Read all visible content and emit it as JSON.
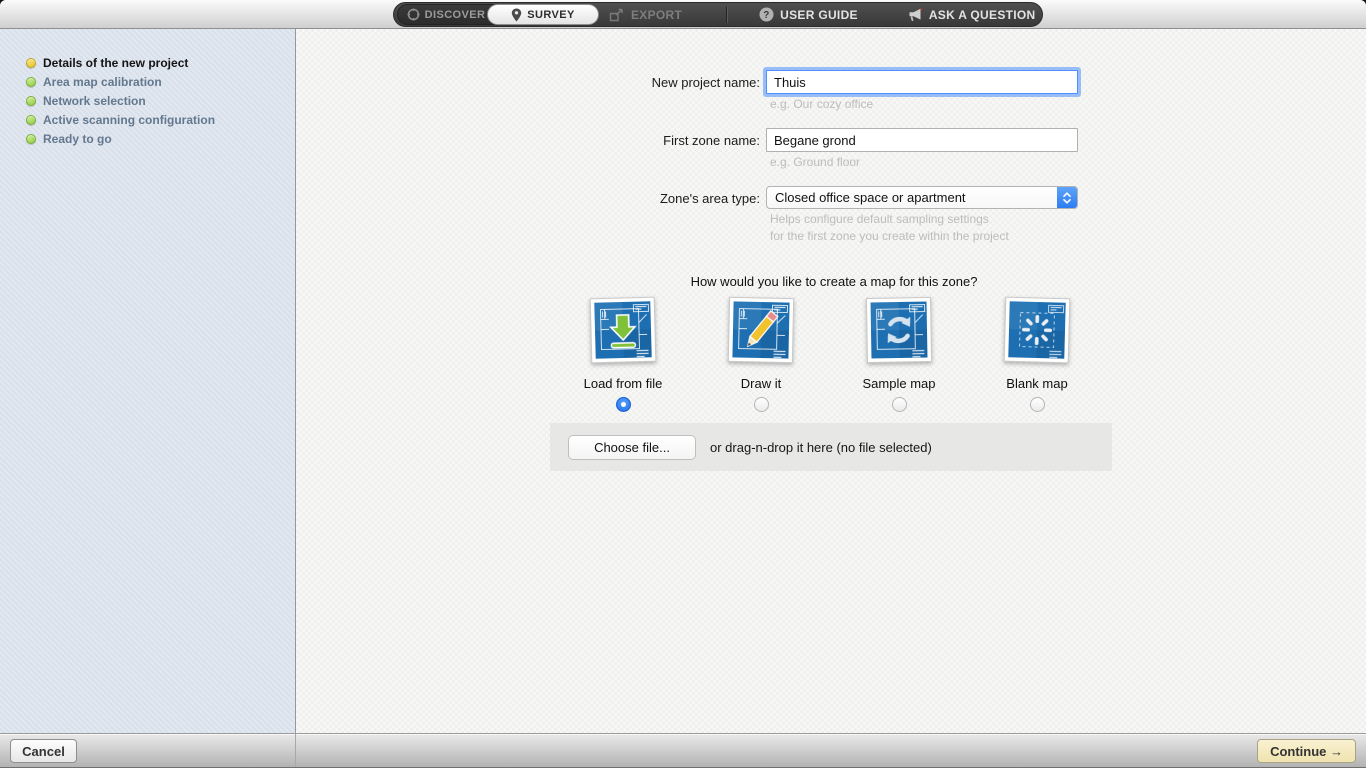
{
  "toolbar": {
    "discover_label": "DISCOVER",
    "survey_label": "SURVEY",
    "export_label": "EXPORT",
    "user_guide_label": "USER GUIDE",
    "ask_question_label": "ASK A QUESTION"
  },
  "sidebar": {
    "steps": [
      {
        "label": "Details of the new project",
        "state": "current"
      },
      {
        "label": "Area map calibration",
        "state": "upcoming"
      },
      {
        "label": "Network selection",
        "state": "upcoming"
      },
      {
        "label": "Active scanning configuration",
        "state": "upcoming"
      },
      {
        "label": "Ready to go",
        "state": "upcoming"
      }
    ]
  },
  "form": {
    "project_name": {
      "label": "New project name:",
      "value": "Thuis",
      "hint": "e.g. Our cozy office"
    },
    "zone_name": {
      "label": "First zone name:",
      "value": "Begane grond",
      "hint": "e.g. Ground floor"
    },
    "area_type": {
      "label": "Zone's area type:",
      "value": "Closed office space or apartment",
      "hint_line1": "Helps configure default sampling settings",
      "hint_line2": "for the first zone you create within the project"
    }
  },
  "map_section": {
    "question": "How would you like to create a map for this zone?",
    "options": [
      {
        "label": "Load from file",
        "icon": "blueprint-download-icon",
        "selected": true
      },
      {
        "label": "Draw it",
        "icon": "blueprint-pencil-icon",
        "selected": false
      },
      {
        "label": "Sample map",
        "icon": "blueprint-sync-icon",
        "selected": false
      },
      {
        "label": "Blank map",
        "icon": "blueprint-spinner-icon",
        "selected": false
      }
    ],
    "file_picker": {
      "button_label": "Choose file...",
      "drop_text": "or drag-n-drop it here (no file selected)"
    }
  },
  "footer": {
    "cancel_label": "Cancel",
    "continue_label": "Continue →"
  },
  "colors": {
    "accent_blue": "#2d7cf2",
    "blueprint_blue": "#1d6fb2",
    "current_step_yellow": "#e6c832",
    "step_green": "#97cf4a",
    "continue_button_cream": "#f3e9c0",
    "sidebar_blue": "#dce3ed",
    "toolbar_capsule_dark": "#444444"
  }
}
